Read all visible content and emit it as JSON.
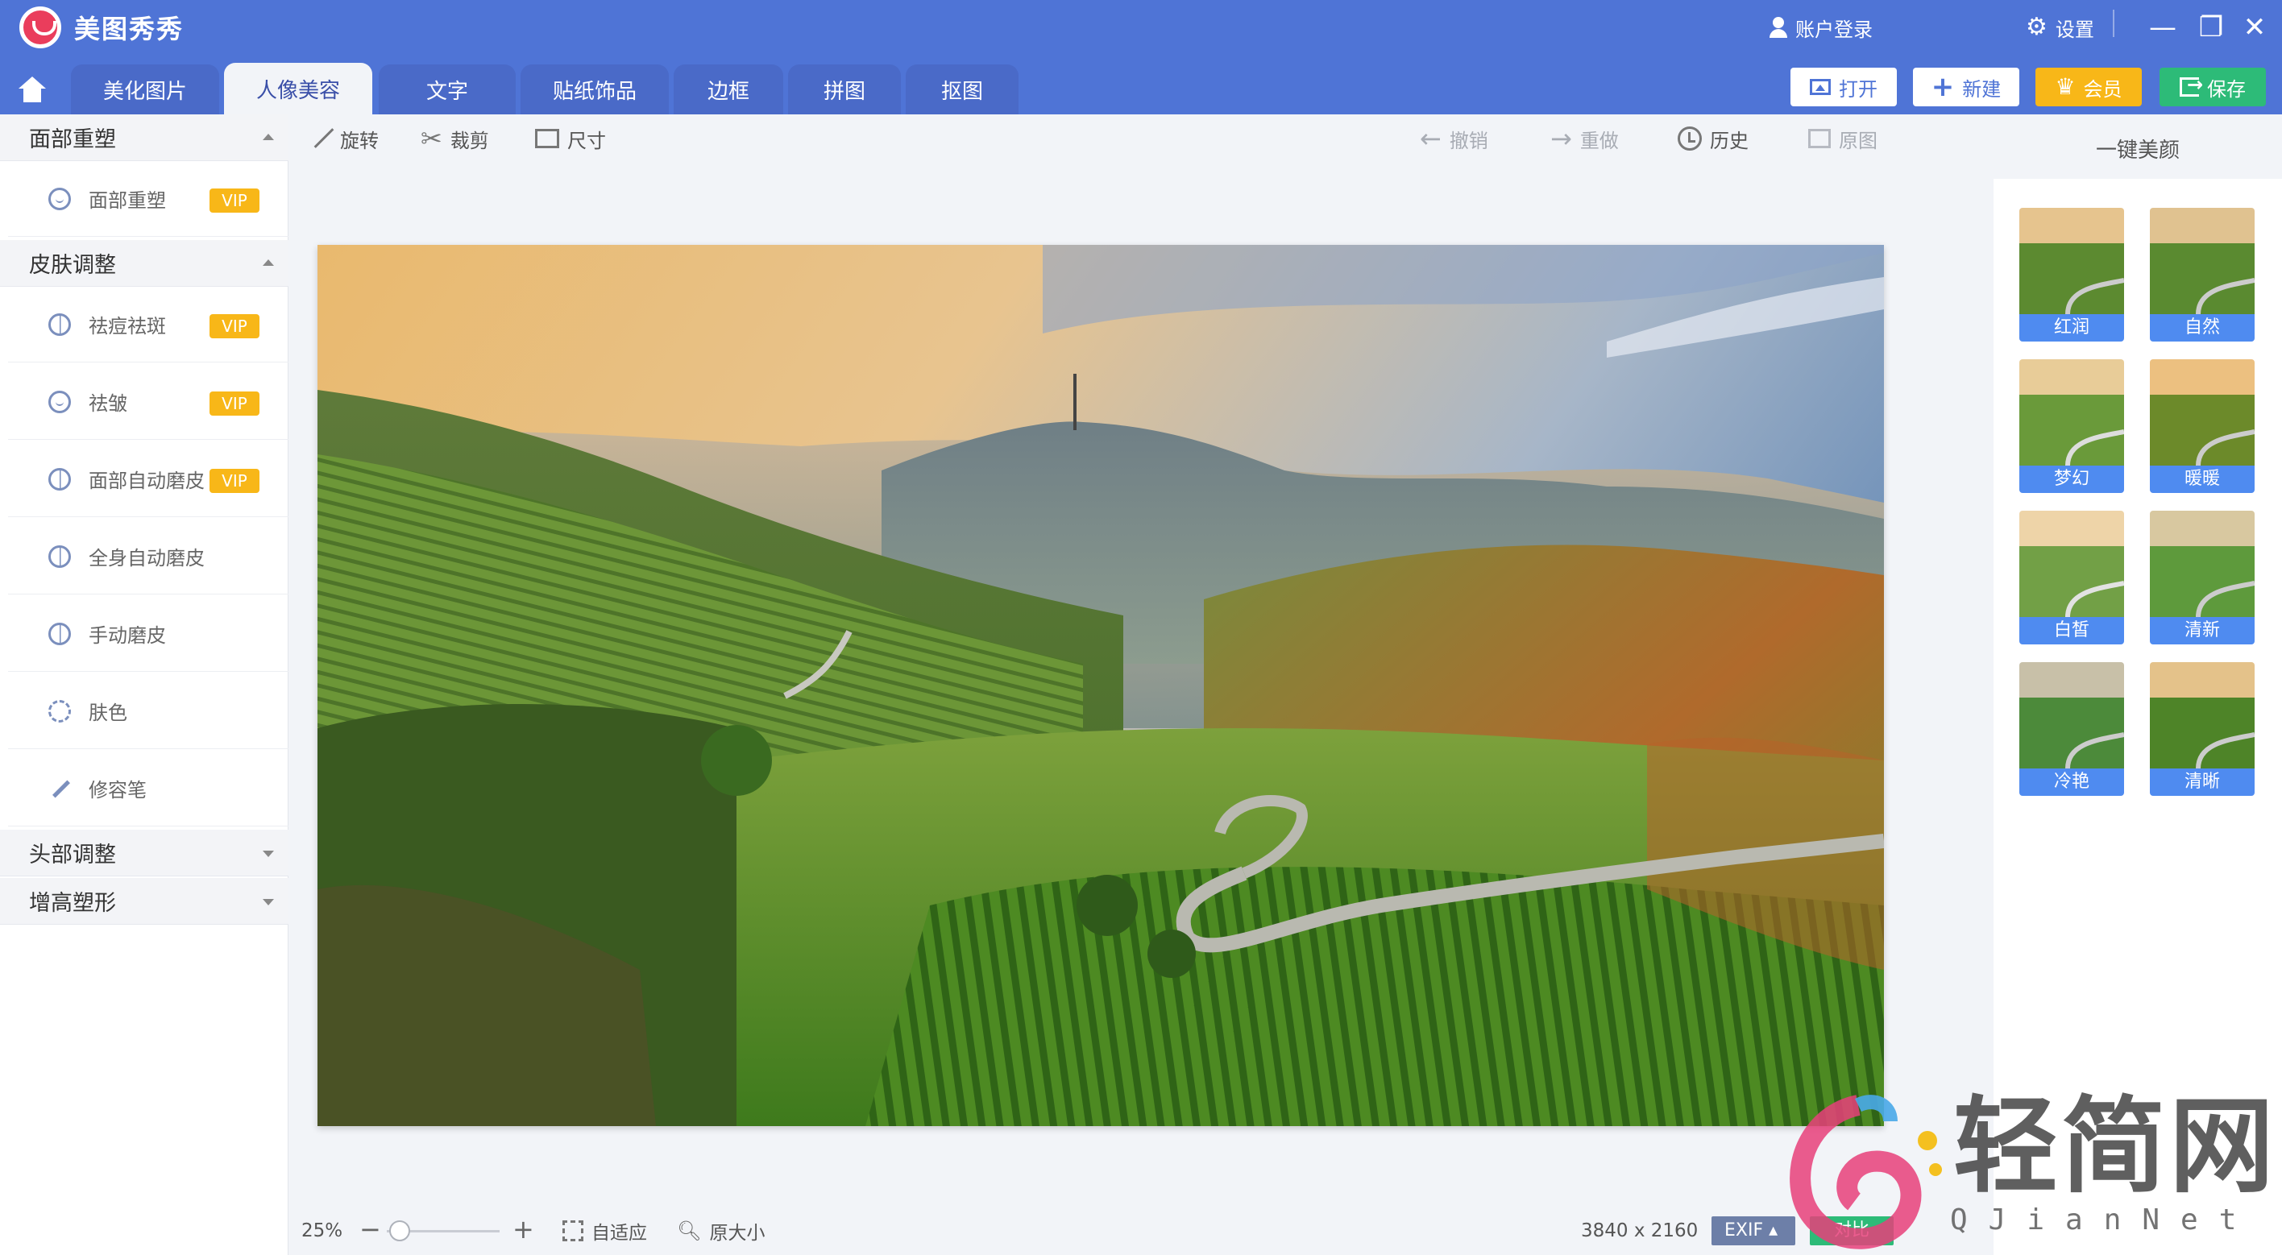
{
  "app": {
    "title": "美图秀秀",
    "account_label": "账户登录",
    "settings_label": "设置",
    "window_controls": [
      "minimize-icon",
      "restore-icon",
      "close-icon"
    ]
  },
  "tabs": [
    {
      "label": "美化图片",
      "active": false
    },
    {
      "label": "人像美容",
      "active": true
    },
    {
      "label": "文字",
      "active": false
    },
    {
      "label": "贴纸饰品",
      "active": false
    },
    {
      "label": "边框",
      "active": false
    },
    {
      "label": "拼图",
      "active": false
    },
    {
      "label": "抠图",
      "active": false
    }
  ],
  "actions": {
    "open_label": "打开",
    "new_label": "新建",
    "vip_label": "会员",
    "save_label": "保存"
  },
  "sidebar": {
    "sections": [
      {
        "title": "面部重塑",
        "expanded": true,
        "items": [
          {
            "label": "面部重塑",
            "vip": "VIP",
            "icon": "face-reshape-icon"
          }
        ]
      },
      {
        "title": "皮肤调整",
        "expanded": true,
        "items": [
          {
            "label": "祛痘祛斑",
            "vip": "VIP",
            "icon": "acne-icon"
          },
          {
            "label": "祛皱",
            "vip": "VIP",
            "icon": "wrinkle-icon"
          },
          {
            "label": "面部自动磨皮",
            "vip": "VIP",
            "icon": "face-smooth-icon"
          },
          {
            "label": "全身自动磨皮",
            "vip": "",
            "icon": "body-smooth-icon"
          },
          {
            "label": "手动磨皮",
            "vip": "",
            "icon": "manual-smooth-icon"
          },
          {
            "label": "肤色",
            "vip": "",
            "icon": "skin-tone-icon"
          },
          {
            "label": "修容笔",
            "vip": "",
            "icon": "contour-brush-icon"
          }
        ]
      },
      {
        "title": "头部调整",
        "expanded": false,
        "items": []
      },
      {
        "title": "增高塑形",
        "expanded": false,
        "items": []
      }
    ]
  },
  "toolbar": {
    "rotate_label": "旋转",
    "crop_label": "裁剪",
    "size_label": "尺寸",
    "undo_label": "撤销",
    "redo_label": "重做",
    "history_label": "历史",
    "original_label": "原图"
  },
  "right_panel": {
    "title": "一键美颜",
    "presets": [
      {
        "label": "红润"
      },
      {
        "label": "自然"
      },
      {
        "label": "梦幻"
      },
      {
        "label": "暖暖"
      },
      {
        "label": "白皙"
      },
      {
        "label": "清新"
      },
      {
        "label": "冷艳"
      },
      {
        "label": "清晰"
      }
    ]
  },
  "status_bar": {
    "zoom": "25%",
    "zoom_fraction": 0.02,
    "fit_label": "自适应",
    "actual_size_label": "原大小",
    "dimensions": "3840 x 2160",
    "exif_label": "EXIF",
    "compare_label": "对比"
  },
  "watermark": {
    "text": "轻简网",
    "subtext": "QJianNet"
  },
  "colors": {
    "header": "#4f74d6",
    "accent_vip": "#f8b718",
    "save_green": "#2dbb78",
    "preset_caption": "#4f8bf0"
  }
}
